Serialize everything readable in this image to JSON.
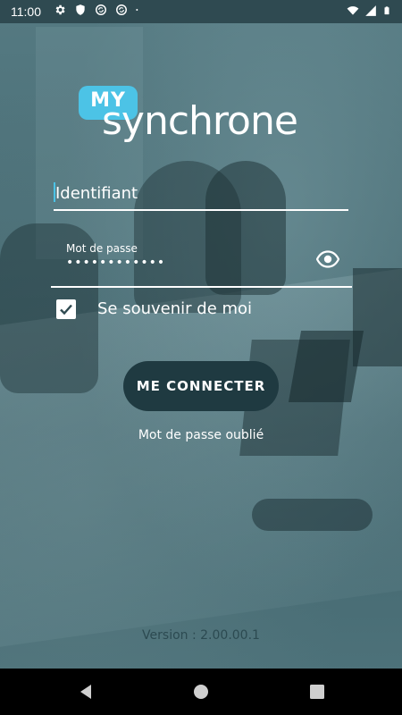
{
  "status_bar": {
    "time": "11:00",
    "icons_left": [
      "gear-icon",
      "shield-icon",
      "sync-icon",
      "sync-icon",
      "dot-icon"
    ],
    "icons_right": [
      "wifi-icon",
      "signal-icon",
      "battery-icon"
    ]
  },
  "logo": {
    "badge": "MY",
    "word": "synchrone",
    "badge_color": "#4cc3e6"
  },
  "login": {
    "identifier_placeholder": "Identifiant",
    "password_label": "Mot de passe",
    "password_value": "••••••••••••",
    "remember_label": "Se souvenir de moi",
    "remember_checked": true,
    "submit_label": "ME CONNECTER",
    "forgot_label": "Mot de passe oublié"
  },
  "footer": {
    "version": "Version : 2.00.00.1"
  },
  "colors": {
    "button_bg": "#1f3a41",
    "accent": "#4cc3e6",
    "text": "#ffffff"
  }
}
